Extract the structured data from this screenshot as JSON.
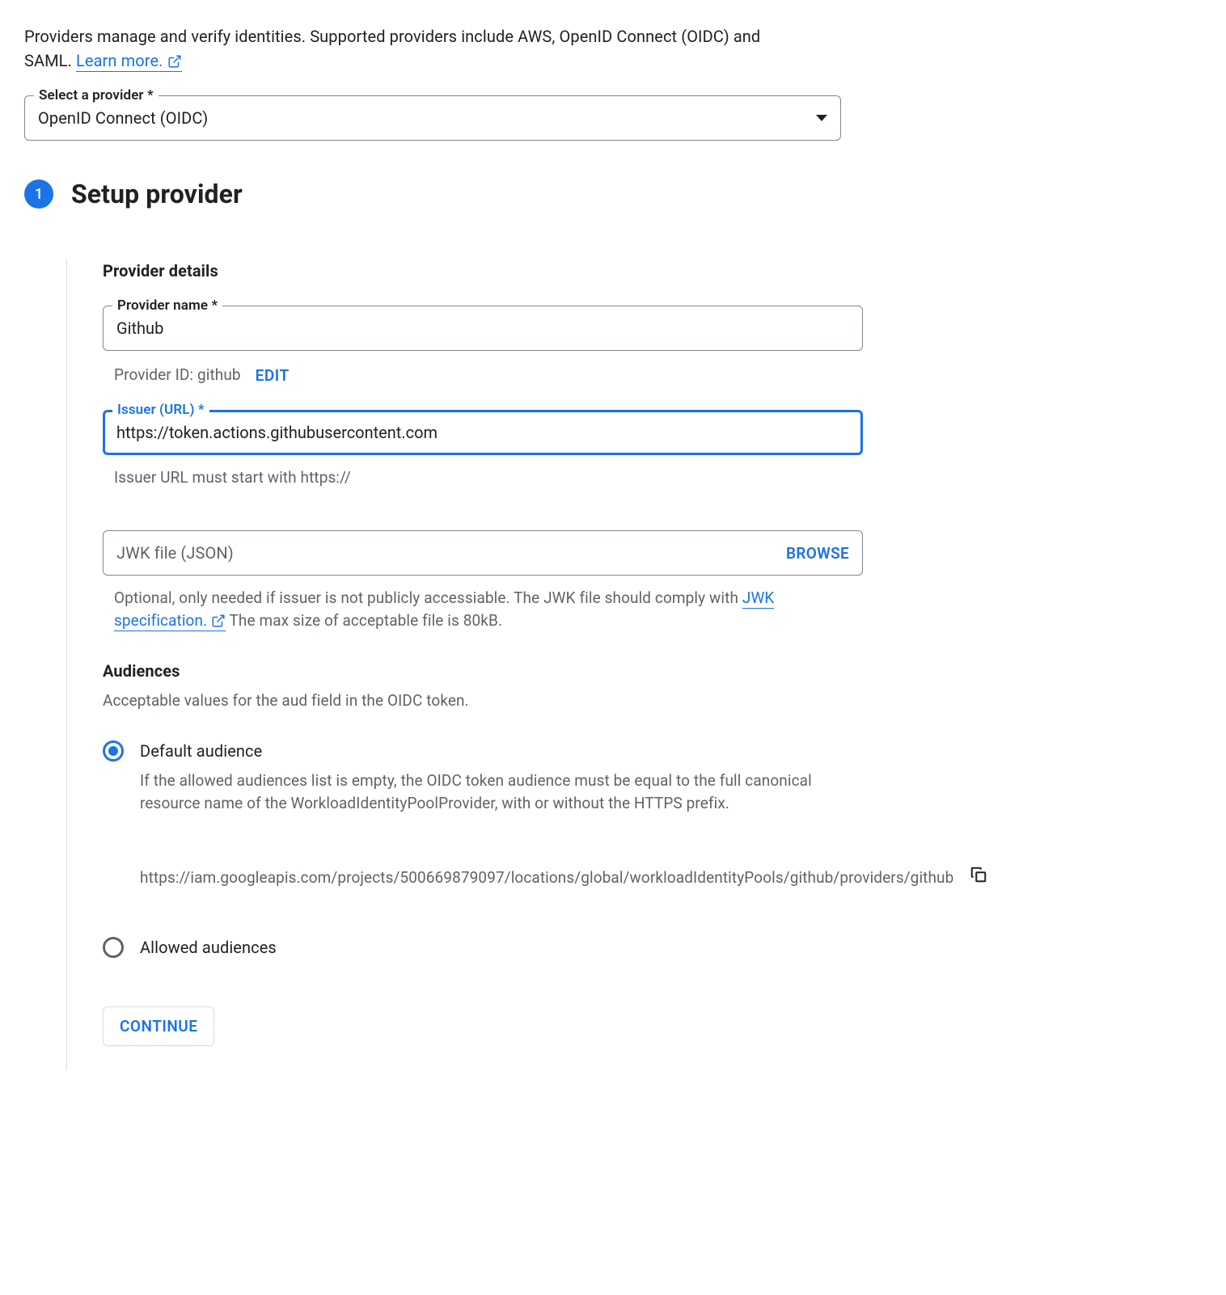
{
  "intro": {
    "text": "Providers manage and verify identities. Supported providers include AWS, OpenID Connect (OIDC) and SAML. ",
    "learn_more": "Learn more."
  },
  "provider_select": {
    "label": "Select a provider *",
    "value": "OpenID Connect (OIDC)"
  },
  "step": {
    "number": "1",
    "title": "Setup provider"
  },
  "details": {
    "heading": "Provider details",
    "provider_name": {
      "label": "Provider name *",
      "value": "Github"
    },
    "provider_id": {
      "prefix": "Provider ID: github",
      "edit": "EDIT"
    },
    "issuer": {
      "label": "Issuer (URL) *",
      "value": "https://token.actions.githubusercontent.com",
      "helper": "Issuer URL must start with https://"
    },
    "jwk": {
      "placeholder": "JWK file (JSON)",
      "browse": "BROWSE",
      "helper_pre": "Optional, only needed if issuer is not publicly accessiable. The JWK file should comply with ",
      "helper_link": "JWK specification.",
      "helper_post": " The max size of acceptable file is 80kB."
    }
  },
  "audiences": {
    "heading": "Audiences",
    "desc": "Acceptable values for the aud field in the OIDC token.",
    "default_label": "Default audience",
    "default_desc": "If the allowed audiences list is empty, the OIDC token audience must be equal to the full canonical resource name of the WorkloadIdentityPoolProvider, with or without the HTTPS prefix.",
    "canonical": "https://iam.googleapis.com/projects/500669879097/locations/global/workloadIdentityPools/github/providers/github",
    "allowed_label": "Allowed audiences"
  },
  "continue": "CONTINUE"
}
